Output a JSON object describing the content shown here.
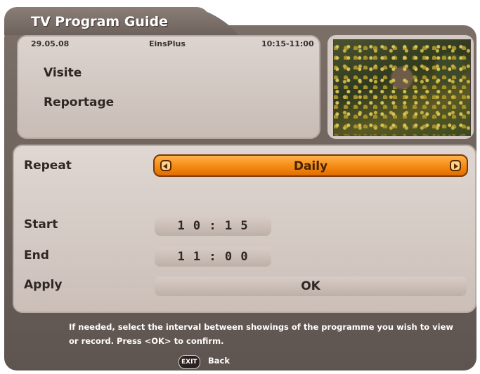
{
  "window": {
    "title": "TV Program Guide"
  },
  "program": {
    "date": "29.05.08",
    "channel": "EinsPlus",
    "time": "10:15-11:00",
    "title": "Visite",
    "subtitle": "Reportage"
  },
  "settings": {
    "repeat_label": "Repeat",
    "repeat_value": "Daily",
    "start_label": "Start",
    "start_value": "1 0 : 1 5",
    "end_label": "End",
    "end_value": "1 1 : 0 0",
    "apply_label": "Apply",
    "apply_value": "OK"
  },
  "footer": {
    "help_text": "If needed, select the interval between showings of the programme you wish to view or record. Press <OK> to confirm.",
    "exit_key": "EXIT",
    "back_label": "Back"
  },
  "colors": {
    "selected_accent": "#f38a12",
    "panel_bg": "#d8cec8"
  },
  "icons": {
    "left_arrow": "arrow-left-icon",
    "right_arrow": "arrow-right-icon"
  }
}
